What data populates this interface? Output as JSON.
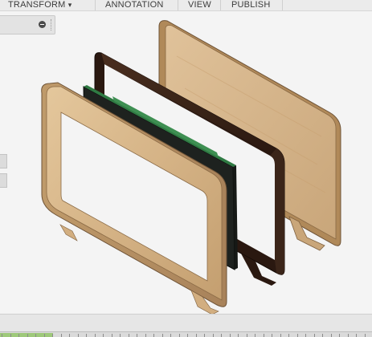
{
  "toolbar": {
    "items": [
      {
        "label": "TRANSFORM",
        "has_dropdown": true,
        "dropdown_glyph": "▾"
      },
      {
        "label": "ANNOTATION"
      },
      {
        "label": "VIEW"
      },
      {
        "label": "PUBLISH"
      }
    ]
  },
  "browser_panel": {
    "collapse_icon": "minus-circle-icon",
    "grip_icon": "grip-dots-icon"
  },
  "viewport": {
    "model": "exploded-frame-assembly",
    "colors": {
      "light_wood": "#d7b789",
      "light_wood_shade": "#b89262",
      "dark_wood": "#3a2418",
      "dark_wood_shade": "#241510",
      "screen": "#222822",
      "pcb_green": "#2f7a43",
      "background": "#f4f4f4"
    }
  },
  "timeline": {
    "active_color": "#9ec97a"
  }
}
